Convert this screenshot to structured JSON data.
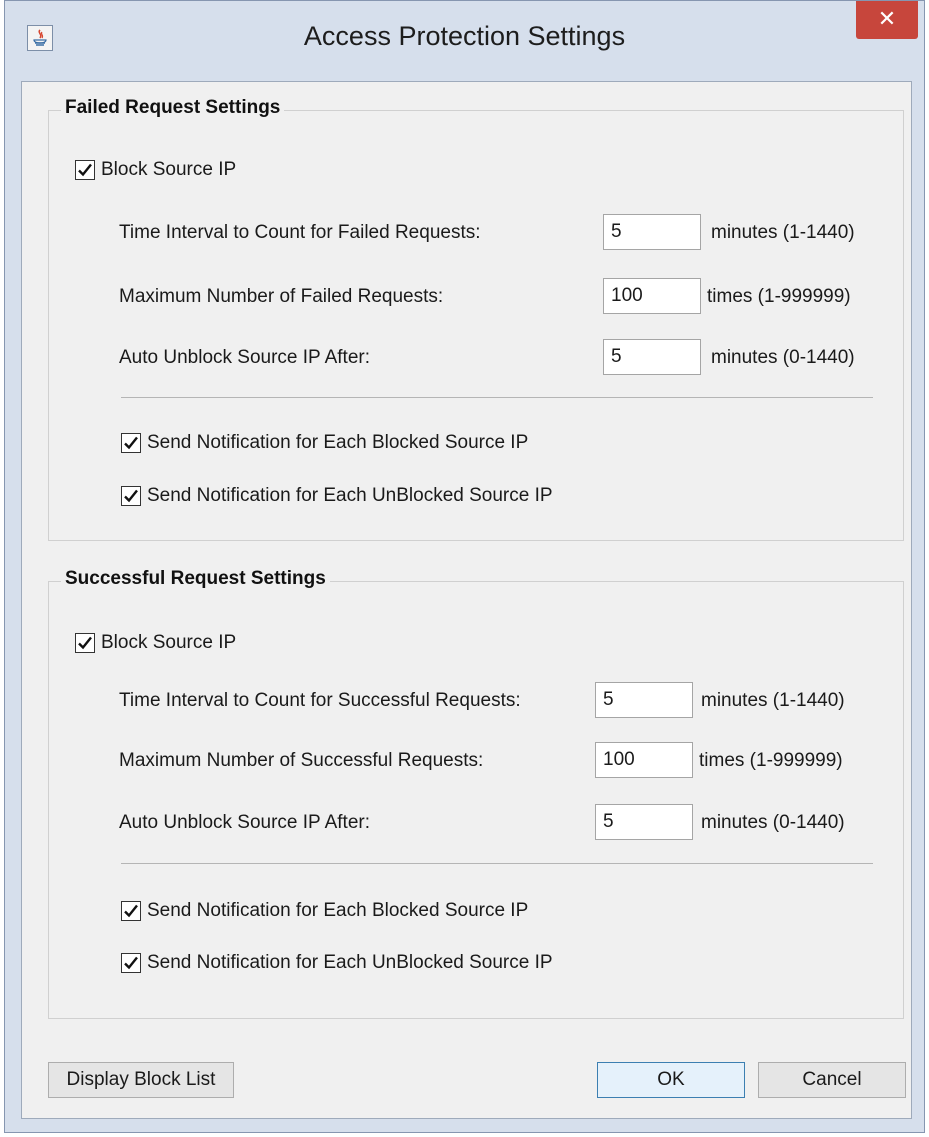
{
  "window": {
    "title": "Access Protection Settings",
    "close_glyph": "✕",
    "app_icon": "java-icon"
  },
  "failed": {
    "title": "Failed Request Settings",
    "block_label": "Block Source IP",
    "block_checked": true,
    "interval_label": "Time Interval to Count for Failed Requests:",
    "interval_value": "5",
    "interval_unit": "minutes (1-1440)",
    "max_label": "Maximum Number of Failed Requests:",
    "max_value": "100",
    "max_unit": "times (1-999999)",
    "unblock_label": "Auto Unblock Source IP After:",
    "unblock_value": "5",
    "unblock_unit": "minutes (0-1440)",
    "notify_blocked_label": "Send Notification for Each Blocked Source IP",
    "notify_blocked_checked": true,
    "notify_unblocked_label": "Send Notification for Each UnBlocked Source IP",
    "notify_unblocked_checked": true
  },
  "successful": {
    "title": "Successful Request Settings",
    "block_label": "Block Source IP",
    "block_checked": true,
    "interval_label": "Time Interval to Count for Successful  Requests:",
    "interval_value": "5",
    "interval_unit": "minutes (1-1440)",
    "max_label": "Maximum Number of Successful Requests:",
    "max_value": "100",
    "max_unit": "times (1-999999)",
    "unblock_label": "Auto Unblock Source IP After:",
    "unblock_value": "5",
    "unblock_unit": "minutes (0-1440)",
    "notify_blocked_label": "Send Notification for Each Blocked Source IP",
    "notify_blocked_checked": true,
    "notify_unblocked_label": "Send Notification for Each UnBlocked Source IP",
    "notify_unblocked_checked": true
  },
  "buttons": {
    "display_block_list": "Display Block List",
    "ok": "OK",
    "cancel": "Cancel"
  }
}
